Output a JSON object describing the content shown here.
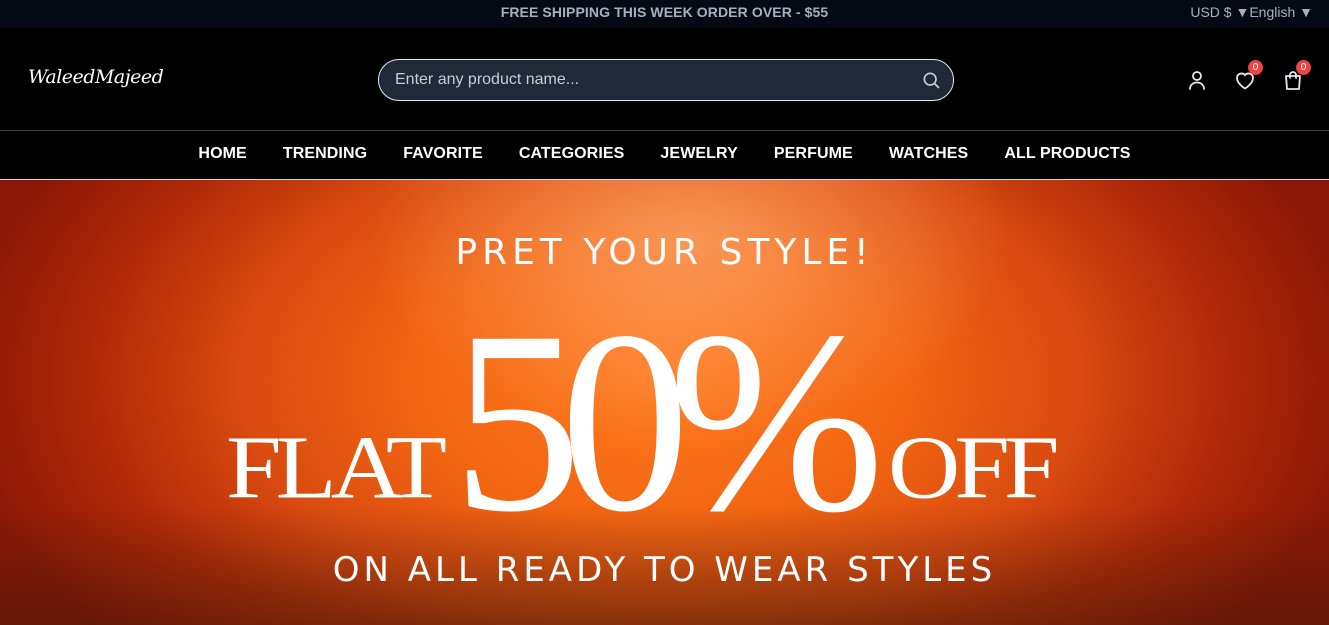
{
  "topbar": {
    "promo": "FREE SHIPPING THIS WEEK ORDER OVER - $55",
    "currency": "USD $ ▼",
    "language": "English ▼"
  },
  "header": {
    "logo": "WaleedMajeed",
    "search_placeholder": "Enter any product name...",
    "wishlist_count": "0",
    "cart_count": "0",
    "icons": [
      "user-icon",
      "heart-icon",
      "shopping-bag-icon",
      "search-icon"
    ]
  },
  "nav": {
    "items": [
      "HOME",
      "TRENDING",
      "FAVORITE",
      "CATEGORIES",
      "JEWELRY",
      "PERFUME",
      "WATCHES",
      "ALL PRODUCTS"
    ]
  },
  "hero": {
    "tagline": "PRET YOUR STYLE!",
    "flat": "FLAT",
    "percent": "50%",
    "off": "OFF",
    "subline": "ON ALL READY TO WEAR STYLES"
  },
  "colors": {
    "topbar_bg": "#050914",
    "header_bg": "#000000",
    "search_bg": "#1f2937",
    "badge": "#ef4444",
    "hero_orange": "#f26512"
  }
}
